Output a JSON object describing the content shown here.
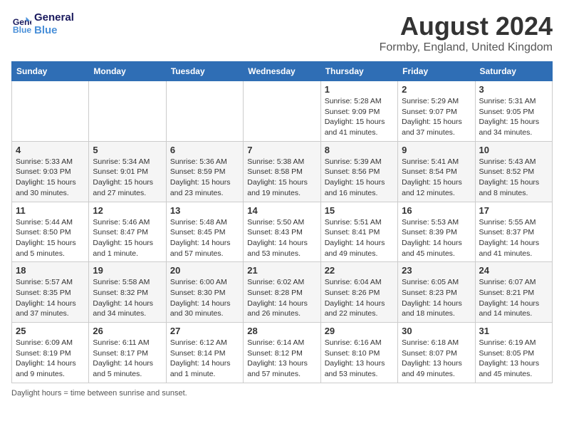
{
  "header": {
    "logo_line1": "General",
    "logo_line2": "Blue",
    "month_title": "August 2024",
    "location": "Formby, England, United Kingdom"
  },
  "weekdays": [
    "Sunday",
    "Monday",
    "Tuesday",
    "Wednesday",
    "Thursday",
    "Friday",
    "Saturday"
  ],
  "weeks": [
    [
      {
        "day": "",
        "info": ""
      },
      {
        "day": "",
        "info": ""
      },
      {
        "day": "",
        "info": ""
      },
      {
        "day": "",
        "info": ""
      },
      {
        "day": "1",
        "info": "Sunrise: 5:28 AM\nSunset: 9:09 PM\nDaylight: 15 hours\nand 41 minutes."
      },
      {
        "day": "2",
        "info": "Sunrise: 5:29 AM\nSunset: 9:07 PM\nDaylight: 15 hours\nand 37 minutes."
      },
      {
        "day": "3",
        "info": "Sunrise: 5:31 AM\nSunset: 9:05 PM\nDaylight: 15 hours\nand 34 minutes."
      }
    ],
    [
      {
        "day": "4",
        "info": "Sunrise: 5:33 AM\nSunset: 9:03 PM\nDaylight: 15 hours\nand 30 minutes."
      },
      {
        "day": "5",
        "info": "Sunrise: 5:34 AM\nSunset: 9:01 PM\nDaylight: 15 hours\nand 27 minutes."
      },
      {
        "day": "6",
        "info": "Sunrise: 5:36 AM\nSunset: 8:59 PM\nDaylight: 15 hours\nand 23 minutes."
      },
      {
        "day": "7",
        "info": "Sunrise: 5:38 AM\nSunset: 8:58 PM\nDaylight: 15 hours\nand 19 minutes."
      },
      {
        "day": "8",
        "info": "Sunrise: 5:39 AM\nSunset: 8:56 PM\nDaylight: 15 hours\nand 16 minutes."
      },
      {
        "day": "9",
        "info": "Sunrise: 5:41 AM\nSunset: 8:54 PM\nDaylight: 15 hours\nand 12 minutes."
      },
      {
        "day": "10",
        "info": "Sunrise: 5:43 AM\nSunset: 8:52 PM\nDaylight: 15 hours\nand 8 minutes."
      }
    ],
    [
      {
        "day": "11",
        "info": "Sunrise: 5:44 AM\nSunset: 8:50 PM\nDaylight: 15 hours\nand 5 minutes."
      },
      {
        "day": "12",
        "info": "Sunrise: 5:46 AM\nSunset: 8:47 PM\nDaylight: 15 hours\nand 1 minute."
      },
      {
        "day": "13",
        "info": "Sunrise: 5:48 AM\nSunset: 8:45 PM\nDaylight: 14 hours\nand 57 minutes."
      },
      {
        "day": "14",
        "info": "Sunrise: 5:50 AM\nSunset: 8:43 PM\nDaylight: 14 hours\nand 53 minutes."
      },
      {
        "day": "15",
        "info": "Sunrise: 5:51 AM\nSunset: 8:41 PM\nDaylight: 14 hours\nand 49 minutes."
      },
      {
        "day": "16",
        "info": "Sunrise: 5:53 AM\nSunset: 8:39 PM\nDaylight: 14 hours\nand 45 minutes."
      },
      {
        "day": "17",
        "info": "Sunrise: 5:55 AM\nSunset: 8:37 PM\nDaylight: 14 hours\nand 41 minutes."
      }
    ],
    [
      {
        "day": "18",
        "info": "Sunrise: 5:57 AM\nSunset: 8:35 PM\nDaylight: 14 hours\nand 37 minutes."
      },
      {
        "day": "19",
        "info": "Sunrise: 5:58 AM\nSunset: 8:32 PM\nDaylight: 14 hours\nand 34 minutes."
      },
      {
        "day": "20",
        "info": "Sunrise: 6:00 AM\nSunset: 8:30 PM\nDaylight: 14 hours\nand 30 minutes."
      },
      {
        "day": "21",
        "info": "Sunrise: 6:02 AM\nSunset: 8:28 PM\nDaylight: 14 hours\nand 26 minutes."
      },
      {
        "day": "22",
        "info": "Sunrise: 6:04 AM\nSunset: 8:26 PM\nDaylight: 14 hours\nand 22 minutes."
      },
      {
        "day": "23",
        "info": "Sunrise: 6:05 AM\nSunset: 8:23 PM\nDaylight: 14 hours\nand 18 minutes."
      },
      {
        "day": "24",
        "info": "Sunrise: 6:07 AM\nSunset: 8:21 PM\nDaylight: 14 hours\nand 14 minutes."
      }
    ],
    [
      {
        "day": "25",
        "info": "Sunrise: 6:09 AM\nSunset: 8:19 PM\nDaylight: 14 hours\nand 9 minutes."
      },
      {
        "day": "26",
        "info": "Sunrise: 6:11 AM\nSunset: 8:17 PM\nDaylight: 14 hours\nand 5 minutes."
      },
      {
        "day": "27",
        "info": "Sunrise: 6:12 AM\nSunset: 8:14 PM\nDaylight: 14 hours\nand 1 minute."
      },
      {
        "day": "28",
        "info": "Sunrise: 6:14 AM\nSunset: 8:12 PM\nDaylight: 13 hours\nand 57 minutes."
      },
      {
        "day": "29",
        "info": "Sunrise: 6:16 AM\nSunset: 8:10 PM\nDaylight: 13 hours\nand 53 minutes."
      },
      {
        "day": "30",
        "info": "Sunrise: 6:18 AM\nSunset: 8:07 PM\nDaylight: 13 hours\nand 49 minutes."
      },
      {
        "day": "31",
        "info": "Sunrise: 6:19 AM\nSunset: 8:05 PM\nDaylight: 13 hours\nand 45 minutes."
      }
    ]
  ],
  "footer": {
    "daylight_label": "Daylight hours"
  }
}
